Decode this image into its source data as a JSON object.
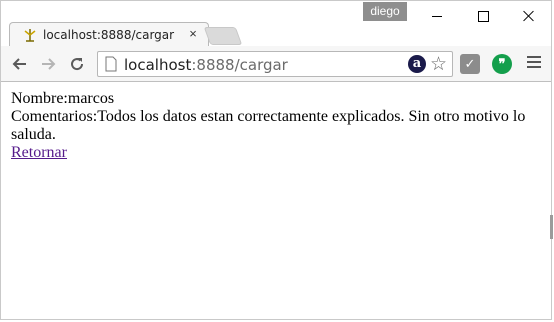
{
  "titlebar": {
    "profile_name": "diego"
  },
  "tab": {
    "title": "localhost:8888/cargar",
    "close_glyph": "×"
  },
  "toolbar": {
    "url_host": "localhost",
    "url_rest": ":8888/cargar",
    "ext_a_label": "a",
    "icons": [
      "back-arrow-icon",
      "forward-arrow-icon",
      "reload-icon",
      "page-icon",
      "star-icon",
      "check-extension-icon",
      "hangouts-icon",
      "menu-icon"
    ]
  },
  "page": {
    "nombre_line": "Nombre:marcos",
    "comentarios_line": "Comentarios:Todos los datos estan correctamente explicados. Sin otro motivo lo saluda.",
    "link_text": "Retornar"
  },
  "colors": {
    "link": "#551a8b",
    "profile_badge": "#8e8e8e",
    "hangouts": "#149f4c"
  }
}
